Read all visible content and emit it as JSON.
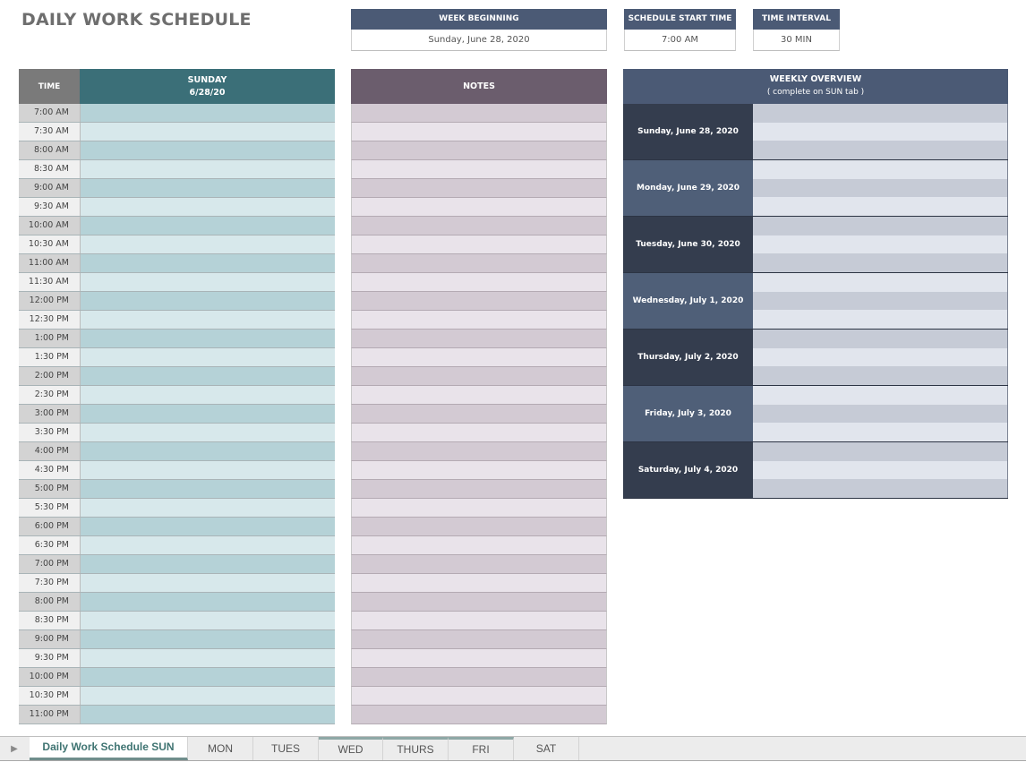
{
  "title": "DAILY WORK SCHEDULE",
  "info": {
    "week_beginning": {
      "label": "WEEK BEGINNING",
      "value": "Sunday, June 28, 2020"
    },
    "start_time": {
      "label": "SCHEDULE START TIME",
      "value": "7:00 AM"
    },
    "interval": {
      "label": "TIME INTERVAL",
      "value": "30 MIN"
    }
  },
  "schedule": {
    "time_header": "TIME",
    "day_name": "SUNDAY",
    "day_date": "6/28/20",
    "times": [
      "7:00 AM",
      "7:30 AM",
      "8:00 AM",
      "8:30 AM",
      "9:00 AM",
      "9:30 AM",
      "10:00 AM",
      "10:30 AM",
      "11:00 AM",
      "11:30 AM",
      "12:00 PM",
      "12:30 PM",
      "1:00 PM",
      "1:30 PM",
      "2:00 PM",
      "2:30 PM",
      "3:00 PM",
      "3:30 PM",
      "4:00 PM",
      "4:30 PM",
      "5:00 PM",
      "5:30 PM",
      "6:00 PM",
      "6:30 PM",
      "7:00 PM",
      "7:30 PM",
      "8:00 PM",
      "8:30 PM",
      "9:00 PM",
      "9:30 PM",
      "10:00 PM",
      "10:30 PM",
      "11:00 PM"
    ]
  },
  "notes": {
    "header": "NOTES"
  },
  "overview": {
    "title": "WEEKLY OVERVIEW",
    "subtitle": "( complete on SUN tab )",
    "days": [
      "Sunday, June 28, 2020",
      "Monday, June 29, 2020",
      "Tuesday, June 30, 2020",
      "Wednesday, July 1, 2020",
      "Thursday, July 2, 2020",
      "Friday, July 3, 2020",
      "Saturday, July 4, 2020"
    ]
  },
  "tabs": {
    "active": "Daily Work Schedule  SUN",
    "items": [
      "MON",
      "TUES",
      "WED",
      "THURS",
      "FRI",
      "SAT"
    ]
  },
  "colors": {
    "time_header": "#7a7a7a",
    "day_header": "#3b6f78",
    "notes_header": "#6b5d6d",
    "overview_header": "#4b5a75"
  }
}
